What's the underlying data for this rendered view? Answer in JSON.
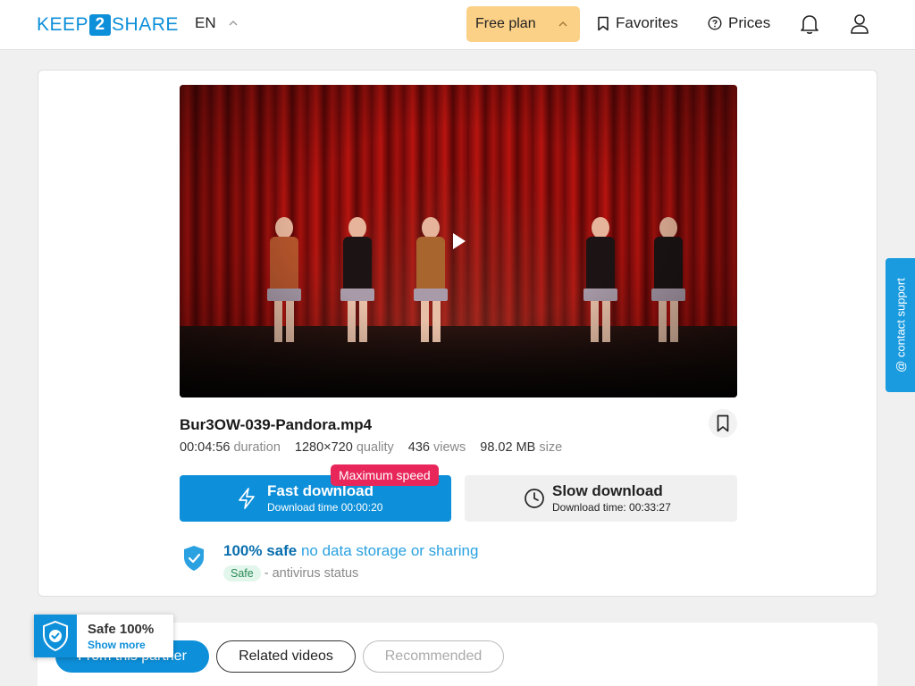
{
  "header": {
    "logo_left": "KEEP",
    "logo_mid": "2",
    "logo_right": "SHARE",
    "language": "EN",
    "plan_label": "Free plan",
    "favorites_label": "Favorites",
    "prices_label": "Prices"
  },
  "file": {
    "name": "Bur3OW-039-Pandora.mp4",
    "duration_value": "00:04:56",
    "duration_label": "duration",
    "quality_value": "1280×720",
    "quality_label": "quality",
    "views_value": "436",
    "views_label": "views",
    "size_value": "98.02 MB",
    "size_label": "size"
  },
  "download": {
    "fast_title": "Fast download",
    "fast_subtitle": "Download time 00:00:20",
    "max_badge": "Maximum speed",
    "slow_title": "Slow download",
    "slow_subtitle": "Download time: 00:33:27"
  },
  "safety": {
    "headline_bold": "100% safe",
    "headline_rest": "no data storage or sharing",
    "pill": "Safe",
    "antivirus_text": "- antivirus status"
  },
  "tabs": [
    {
      "label": "From this partner",
      "active": true
    },
    {
      "label": "Related videos",
      "active": false
    },
    {
      "label": "Recommended",
      "active": false
    }
  ],
  "safe_widget": {
    "title": "Safe 100%",
    "link": "Show more"
  },
  "support": {
    "label": "@ contact support"
  },
  "colors": {
    "brand": "#0d8fd9",
    "plan_button": "#fbd087",
    "badge": "#e8265a"
  }
}
